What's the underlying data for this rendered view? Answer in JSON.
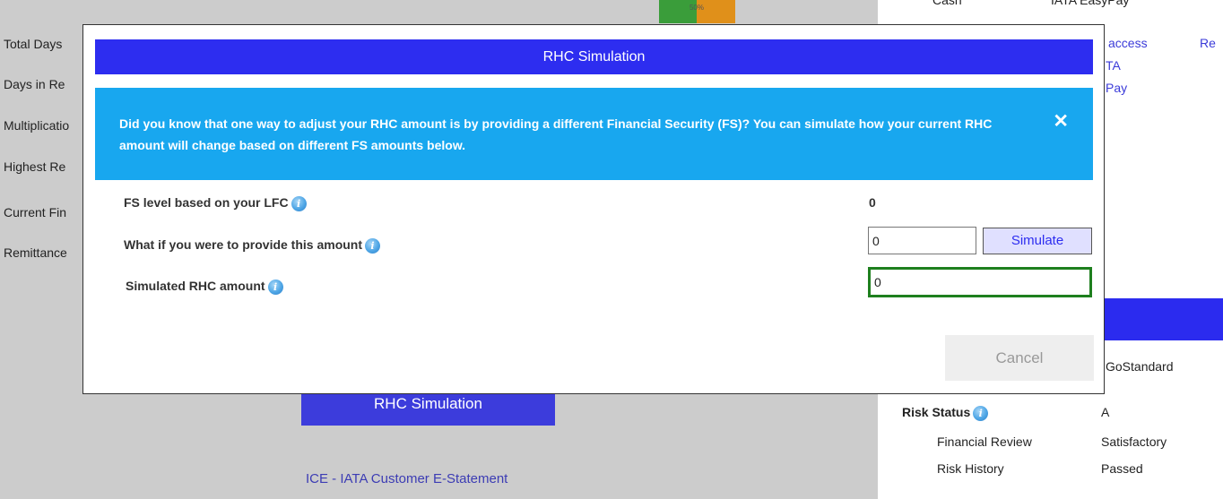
{
  "background_left": {
    "labels": [
      "Total Days",
      "Days in Re",
      "Multiplicatio",
      "Highest Re",
      "Current Fin",
      "Remittance"
    ],
    "gauge_label": "50%",
    "rhc_simulation_button": "RHC Simulation",
    "ice_link": "ICE - IATA Customer E-Statement"
  },
  "background_right": {
    "header_cash": "Cash",
    "header_easypay": "IATA EasyPay",
    "link_access": "access",
    "link_re": "Re",
    "link_ta": "TA",
    "link_pay": "Pay",
    "gostandard": "GoStandard",
    "risk_status_label": "Risk Status",
    "risk_status_value": "A",
    "financial_review_label": "Financial Review",
    "financial_review_value": "Satisfactory",
    "risk_history_label": "Risk History",
    "risk_history_value": "Passed"
  },
  "modal": {
    "title": "RHC Simulation",
    "info_text": "Did you know that one way to adjust your RHC amount is by providing a different Financial Security (FS)? You can simulate how your current RHC amount will change based on different FS amounts below.",
    "close_symbol": "✕",
    "fs_level_label": "FS level based on your LFC",
    "fs_level_value": "0",
    "what_if_label": "What if you were to provide this amount",
    "amount_input_value": "0",
    "simulate_button": "Simulate",
    "simulated_label": "Simulated RHC amount",
    "simulated_value": "0",
    "cancel_button": "Cancel"
  },
  "colors": {
    "header_blue": "#2d2df0",
    "info_blue": "#18a7ef",
    "success_green": "#1e7f1e",
    "gauge_green": "#3a9d3a",
    "gauge_orange": "#e0901a"
  },
  "icons": {
    "info": "info-icon",
    "close": "close-icon"
  }
}
